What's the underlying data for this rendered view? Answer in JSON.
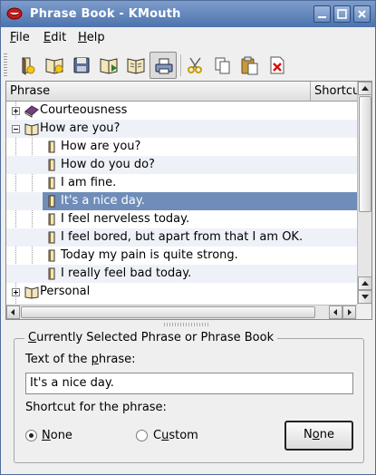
{
  "window": {
    "title": "Phrase Book - KMouth"
  },
  "menu": {
    "file": {
      "accel": "F",
      "rest": "ile"
    },
    "edit": {
      "accel": "E",
      "rest": "dit"
    },
    "help": {
      "accel": "H",
      "rest": "elp"
    }
  },
  "toolbar": {
    "icons": [
      "new-phrase-icon",
      "new-phrase-book-icon",
      "save-icon",
      "import-icon",
      "import-standard-icon",
      "print-icon",
      "cut-icon",
      "copy-icon",
      "paste-icon",
      "delete-icon"
    ]
  },
  "tree": {
    "columns": [
      "Phrase",
      "Shortcut"
    ],
    "rows": [
      {
        "label": "Courteousness",
        "type": "book",
        "state": "collapsed"
      },
      {
        "label": "How are you?",
        "type": "book",
        "state": "expanded"
      },
      {
        "label": "How are you?",
        "type": "phrase"
      },
      {
        "label": "How do you do?",
        "type": "phrase"
      },
      {
        "label": "I am fine.",
        "type": "phrase"
      },
      {
        "label": "It's a nice day.",
        "type": "phrase",
        "selected": true
      },
      {
        "label": "I feel nerveless today.",
        "type": "phrase"
      },
      {
        "label": "I feel bored, but apart from that I am OK.",
        "type": "phrase"
      },
      {
        "label": "Today my pain is quite strong.",
        "type": "phrase"
      },
      {
        "label": "I really feel bad today.",
        "type": "phrase"
      },
      {
        "label": "Personal",
        "type": "book",
        "state": "collapsed"
      }
    ]
  },
  "editor": {
    "group_title": {
      "accel": "C",
      "rest": "urrently Selected Phrase or Phrase Book"
    },
    "text_label": {
      "before": "Text of the ",
      "accel": "p",
      "after": "hrase:"
    },
    "text_value": "It's a nice day.",
    "shortcut_label": "Shortcut for the phrase:",
    "radio_none": {
      "accel": "N",
      "rest": "one",
      "checked": true
    },
    "radio_custom": {
      "before": "C",
      "accel": "u",
      "after": "stom",
      "checked": false
    },
    "shortcut_button": {
      "before": "N",
      "accel": "o",
      "after": "ne"
    }
  },
  "colors": {
    "titlebar": "#5a7eb6",
    "selection": "#6f8db8",
    "alt_row": "#eef2f8"
  }
}
